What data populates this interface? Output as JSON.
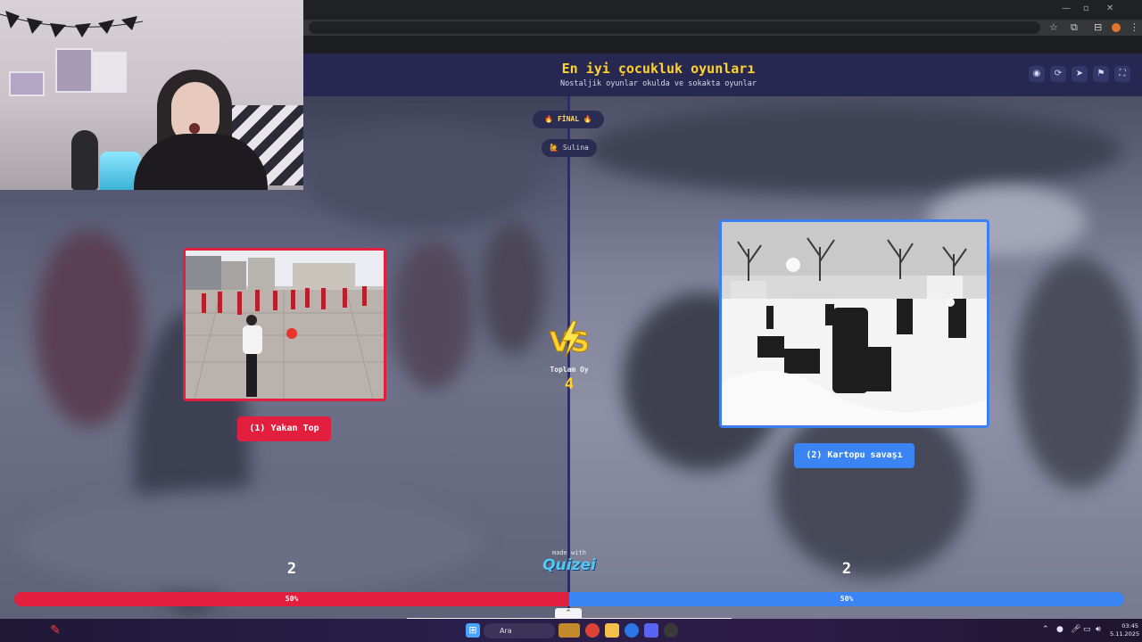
{
  "browser": {
    "window_controls": [
      "—",
      "▫",
      "✕"
    ],
    "toolbar_icons": [
      "star-icon",
      "extensions-icon",
      "tab-search-icon",
      "profile-icon",
      "menu-icon"
    ]
  },
  "header": {
    "title": "En iyi çocukluk oyunları",
    "subtitle": "Nostaljik oyunlar okulda ve sokakta oyunlar",
    "buttons": [
      "eye-icon",
      "share-icon",
      "send-icon",
      "flag-icon",
      "fullscreen-icon"
    ]
  },
  "round": {
    "badge": "🔥 FİNAL 🔥",
    "user": "🙋 Sulina"
  },
  "left_option": {
    "label": "(1) Yakan Top",
    "votes": "2",
    "percent_label": "50%",
    "percent": 50,
    "color": "#e31f3f"
  },
  "right_option": {
    "label": "(2) Kartopu savaşı",
    "votes": "2",
    "percent_label": "50%",
    "percent": 50,
    "color": "#3a84f4"
  },
  "center": {
    "vs": "VS",
    "total_label": "Toplam Oy",
    "total_value": "4"
  },
  "branding": {
    "made_with": "made with",
    "name": "Quizei"
  },
  "taskbar": {
    "search_placeholder": "Ara",
    "time": "03:45",
    "date": "5.11.2025"
  }
}
